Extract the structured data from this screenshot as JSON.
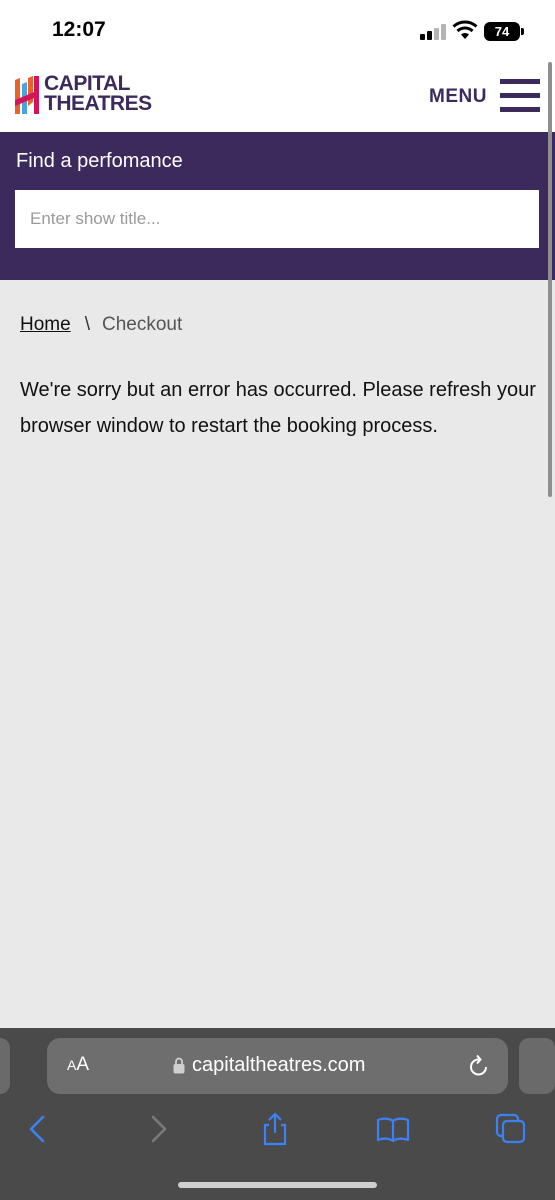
{
  "status_bar": {
    "time": "12:07",
    "battery": "74"
  },
  "header": {
    "logo_line1": "CAPITAL",
    "logo_line2": "THEATRES",
    "menu_label": "MENU"
  },
  "search": {
    "title": "Find a perfomance",
    "placeholder": "Enter show title..."
  },
  "breadcrumb": {
    "home": "Home",
    "separator": "\\",
    "current": "Checkout"
  },
  "message": "We're sorry but an error has occurred. Please refresh your browser window to restart the booking process.",
  "browser": {
    "text_size_label_small": "A",
    "text_size_label_large": "A",
    "url": "capitaltheatres.com"
  },
  "colors": {
    "brand_purple": "#3d2a5c",
    "page_background": "#e9e9e9",
    "safari_blue": "#3b82f6"
  }
}
